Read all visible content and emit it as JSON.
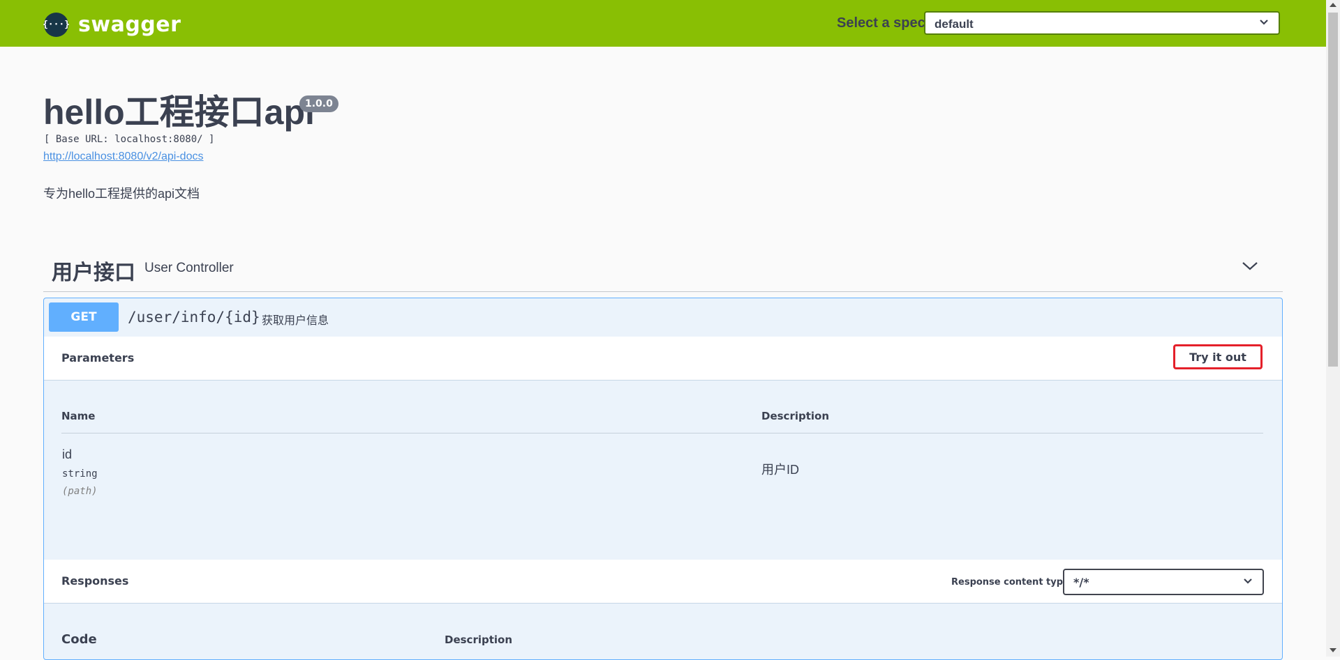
{
  "topbar": {
    "logo_icon": "{···}",
    "logo_text": "swagger",
    "spec_label": "Select a spec",
    "spec_value": "default"
  },
  "info": {
    "title": "hello工程接口api",
    "version": "1.0.0",
    "base_url": "[ Base URL: localhost:8080/ ]",
    "docs_link": "http://localhost:8080/v2/api-docs",
    "description": "专为hello工程提供的api文档"
  },
  "tag": {
    "name": "用户接口",
    "description": "User Controller"
  },
  "operation": {
    "method": "GET",
    "path": "/user/info/{id}",
    "summary": "获取用户信息",
    "parameters": {
      "title": "Parameters",
      "try_label": "Try it out",
      "columns": [
        "Name",
        "Description"
      ],
      "items": [
        {
          "name": "id",
          "type": "string",
          "in": "(path)",
          "description": "用户ID"
        }
      ]
    },
    "responses": {
      "title": "Responses",
      "content_type_label": "Response content type",
      "content_type_value": "*/*",
      "columns": [
        "Code",
        "Description"
      ]
    }
  },
  "colors": {
    "topbar": "#89bf04",
    "get": "#61affe",
    "highlight": "#e4202a"
  },
  "icons": [
    "swagger-logo-icon",
    "chevron-down-icon"
  ]
}
